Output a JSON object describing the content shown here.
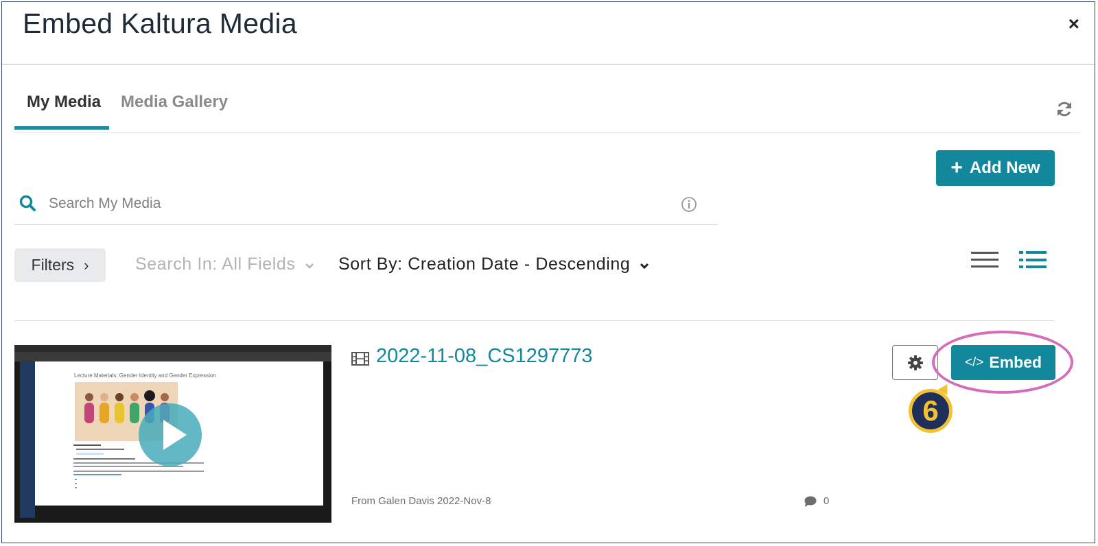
{
  "dialog": {
    "title": "Embed Kaltura Media",
    "close_label": "×"
  },
  "tabs": [
    {
      "label": "My Media",
      "active": true
    },
    {
      "label": "Media Gallery",
      "active": false
    }
  ],
  "toolbar": {
    "add_new_label": "Add New",
    "refresh_icon": "refresh-icon"
  },
  "search": {
    "placeholder": "Search My Media",
    "value": ""
  },
  "filters": {
    "filters_label": "Filters",
    "search_in": "Search In: All Fields",
    "sort_by": "Sort By: Creation Date - Descending"
  },
  "view_modes": [
    "list-view-icon",
    "detailed-view-icon"
  ],
  "media_items": [
    {
      "title": "2022-11-08_CS1297773",
      "meta": "From Galen Davis 2022-Nov-8",
      "comments": "0",
      "embed_label": "Embed",
      "thumbnail_title": "Lecture Materials: Gender Identity and Gender Expression"
    }
  ],
  "annotation": {
    "step_number": "6"
  },
  "colors": {
    "accent": "#13879b",
    "highlight_ring": "#d56bb9",
    "badge_fill": "#1d2f5a",
    "badge_ring": "#f2c233"
  }
}
